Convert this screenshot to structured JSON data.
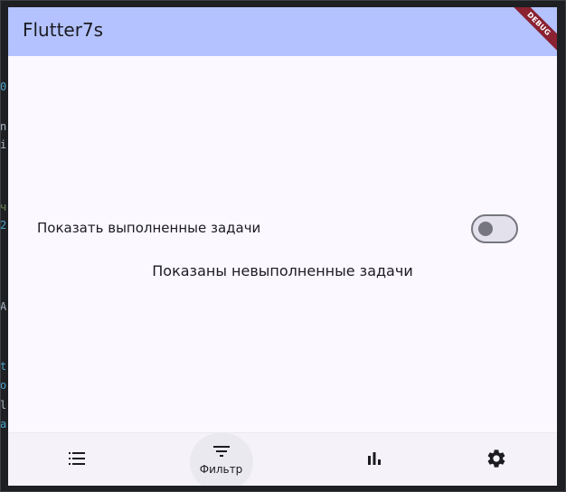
{
  "app": {
    "title": "Flutter7s",
    "debug_banner": "DEBUG"
  },
  "main": {
    "switch_label": "Показать выполненные задачи",
    "switch_on": false,
    "status_text": "Показаны невыполненные задачи"
  },
  "bottom_nav": {
    "items": [
      {
        "icon": "list-icon",
        "label": "",
        "selected": false
      },
      {
        "icon": "filter-icon",
        "label": "Фильтр",
        "selected": true
      },
      {
        "icon": "bar-chart-icon",
        "label": "",
        "selected": false
      },
      {
        "icon": "settings-icon",
        "label": "",
        "selected": false
      }
    ]
  },
  "background_code": {
    "fragments": [
      "0",
      "n",
      "i",
      "ч",
      "2",
      "A",
      "t",
      "o",
      "l",
      "a"
    ]
  },
  "colors": {
    "appbar": "#b4c3ff",
    "surface": "#fbf8ff",
    "debug_ribbon": "#8a2232",
    "switch_outline": "#767680"
  }
}
